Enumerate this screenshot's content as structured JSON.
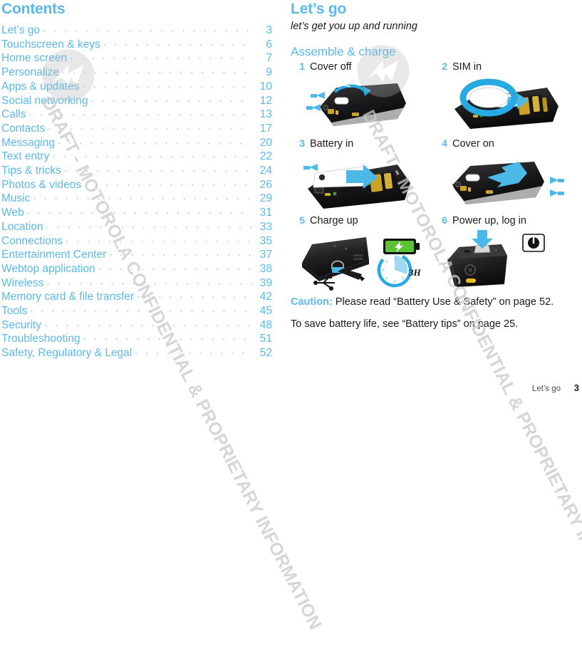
{
  "document": {
    "watermark": "DRAFT - MOTOROLA CONFIDENTIAL & PROPRIETARY INFORMATION",
    "logo_name": "motorola-batwing-logo",
    "accent_color": "#5bb8e8",
    "dot_color": "#8ccff0",
    "text_color": "#1a1a1a"
  },
  "contents": {
    "title": "Contents",
    "dots": ". . . . . . . . . . . . . . . . . . . . . . . . . . . . . . . . . . . . . . . . . . . . . . . . . . . . . . . . . . . . .",
    "entries": [
      {
        "label": "Let’s go",
        "page": "3"
      },
      {
        "label": "Touchscreen & keys",
        "page": "6"
      },
      {
        "label": "Home screen",
        "page": "7"
      },
      {
        "label": "Personalize",
        "page": "9"
      },
      {
        "label": "Apps & updates",
        "page": "10"
      },
      {
        "label": "Social networking",
        "page": "12"
      },
      {
        "label": "Calls",
        "page": "13"
      },
      {
        "label": "Contacts",
        "page": "17"
      },
      {
        "label": "Messaging",
        "page": "20"
      },
      {
        "label": "Text entry",
        "page": "22"
      },
      {
        "label": "Tips & tricks",
        "page": "24"
      },
      {
        "label": "Photos & videos",
        "page": "26"
      },
      {
        "label": "Music",
        "page": "29"
      },
      {
        "label": "Web",
        "page": "31"
      },
      {
        "label": "Location",
        "page": "33"
      },
      {
        "label": "Connections",
        "page": "35"
      },
      {
        "label": "Entertainment Center",
        "page": "37"
      },
      {
        "label": "Webtop application",
        "page": "38"
      },
      {
        "label": "Wireless",
        "page": "39"
      },
      {
        "label": "Memory card & file transfer",
        "page": "42"
      },
      {
        "label": "Tools",
        "page": "45"
      },
      {
        "label": "Security",
        "page": "48"
      },
      {
        "label": "Troubleshooting",
        "page": "51"
      },
      {
        "label": "Safety, Regulatory & Legal",
        "page": "52"
      }
    ]
  },
  "chapter": {
    "title": "Let’s go",
    "subtitle": "let’s get you up and running",
    "section_title": "Assemble & charge",
    "steps": [
      {
        "num": "1",
        "label": "Cover off",
        "art": "phone-back-cover-off"
      },
      {
        "num": "2",
        "label": "SIM in",
        "art": "phone-sim-insert"
      },
      {
        "num": "3",
        "label": "Battery in",
        "art": "phone-battery-insert"
      },
      {
        "num": "4",
        "label": "Cover on",
        "art": "phone-back-cover-on"
      },
      {
        "num": "5",
        "label": "Charge up",
        "art": "phone-usb-charge"
      },
      {
        "num": "6",
        "label": "Power up, log in",
        "art": "phone-power-button"
      }
    ],
    "charge_art": {
      "battery_icon": "battery-charging-icon",
      "timer_icon": "clock-timer-icon",
      "timer_label": "3H",
      "usb_icon": "usb-icon"
    },
    "power_art": {
      "power_icon": "power-button-icon"
    },
    "caution_label": "Caution:",
    "caution_text": " Please read “Battery Use & Safety” on page 52.",
    "tip_text": "To save battery life, see “Battery tips” on page 25."
  },
  "footer": {
    "chapter": "Let’s go",
    "page": "3"
  }
}
